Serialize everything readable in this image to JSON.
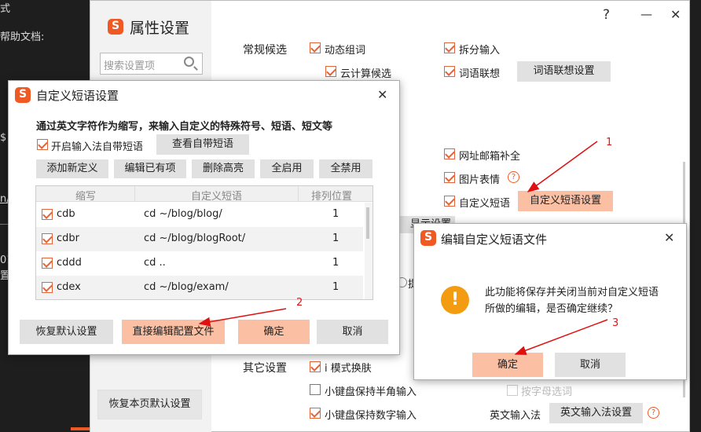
{
  "background_editor": {
    "line1": "式",
    "line2": "帮助文档:",
    "frag_dollar": "$",
    "frag_n": "n/",
    "frag_01": "01",
    "frag_zhi": "置"
  },
  "props_window": {
    "title": "属性设置",
    "help": "?",
    "minimize": "—",
    "close": "✕",
    "search_placeholder": "搜索设置项",
    "restore_default": "恢复本页默认设置",
    "groups": {
      "normal_candidates": "常规候选",
      "other_settings": "其它设置"
    },
    "options": {
      "dynamic_group": "动态组词",
      "split_input": "拆分输入",
      "cloud_candidate": "云计算候选",
      "word_assoc": "词语联想",
      "word_assoc_settings": "词语联想设置",
      "email_complete": "网址邮箱补全",
      "emoji": "图片表情",
      "custom_phrase": "自定义短语",
      "custom_phrase_settings": "自定义短语设置",
      "partial_button": "显示设置",
      "partial_radio": "提",
      "i_mode": "i 模式换肤",
      "half_width": "小键盘保持半角输入",
      "keep_number": "小键盘保持数字输入",
      "hidden_option": "按字母选词",
      "english_input": "英文输入法",
      "english_input_settings": "英文输入法设置"
    }
  },
  "custom_phrase_dialog": {
    "title": "自定义短语设置",
    "description": "通过英文字符作为缩写，来输入自定义的特殊符号、短语、短文等",
    "enable_builtin": "开启输入法自带短语",
    "view_builtin": "查看自带短语",
    "buttons": {
      "add": "添加新定义",
      "edit": "编辑已有项",
      "delete": "删除高亮",
      "enable_all": "全启用",
      "disable_all": "全禁用"
    },
    "columns": [
      "缩写",
      "自定义短语",
      "排列位置"
    ],
    "rows": [
      {
        "abbr": "cdb",
        "phrase": "cd ~/blog/blog/",
        "pos": "1"
      },
      {
        "abbr": "cdbr",
        "phrase": "cd ~/blog/blogRoot/",
        "pos": "1"
      },
      {
        "abbr": "cddd",
        "phrase": "cd ..",
        "pos": "1"
      },
      {
        "abbr": "cdex",
        "phrase": "cd ~/blog/exam/",
        "pos": "1"
      }
    ],
    "footer": {
      "restore": "恢复默认设置",
      "direct_edit": "直接编辑配置文件",
      "ok": "确定",
      "cancel": "取消"
    }
  },
  "edit_file_dialog": {
    "title": "编辑自定义短语文件",
    "warning_icon": "!",
    "message": "此功能将保存并关闭当前对自定义短语所做的编辑，是否确定继续？",
    "ok": "确定",
    "cancel": "取消"
  },
  "annotations": [
    "1",
    "2",
    "3"
  ],
  "colors": {
    "brand": "#ef5a24",
    "highlight_button": "#fbbfa4",
    "arrow": "#e01010",
    "warning": "#f39c12"
  }
}
